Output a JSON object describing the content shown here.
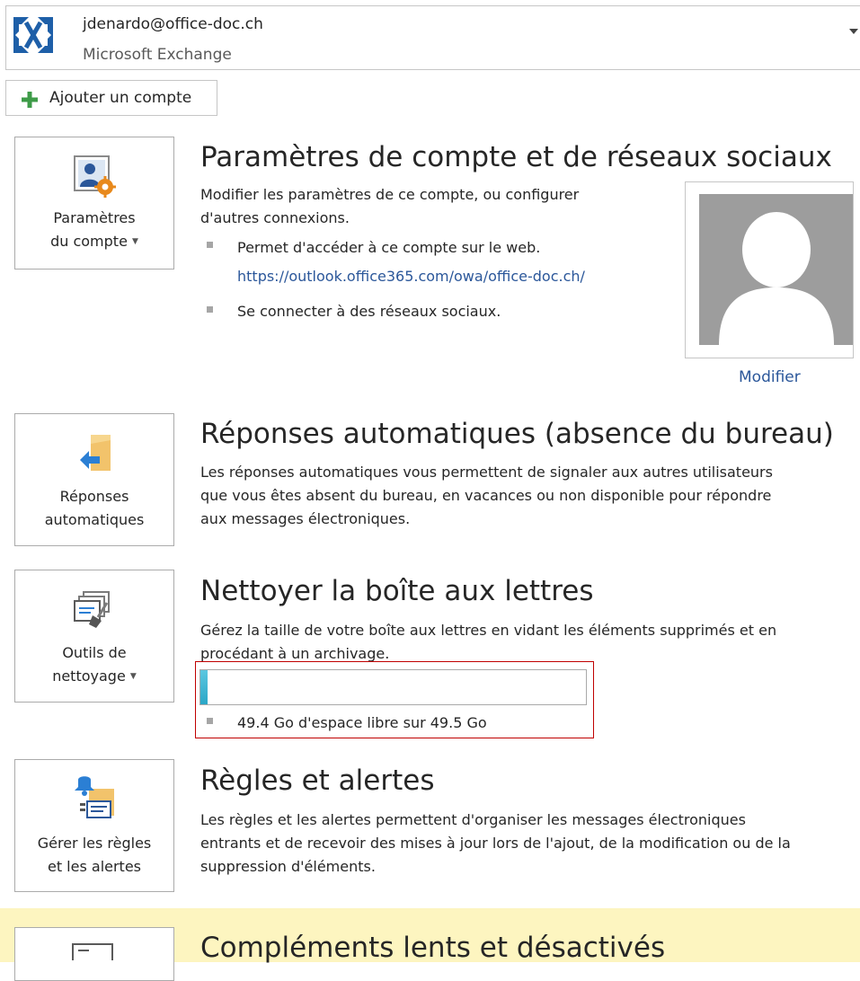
{
  "account": {
    "email": "jdenardo@office-doc.ch",
    "type": "Microsoft Exchange"
  },
  "add_account_label": "Ajouter un compte",
  "sections": {
    "account_settings": {
      "tile_line1": "Paramètres",
      "tile_line2": "du compte",
      "title": "Paramètres de compte et de réseaux sociaux",
      "desc_line1": "Modifier les paramètres de ce compte, ou configurer",
      "desc_line2": "d'autres connexions.",
      "bullet1": "Permet d'accéder à ce compte sur le web.",
      "link": "https://outlook.office365.com/owa/office-doc.ch/",
      "bullet2": "Se connecter à des réseaux sociaux.",
      "photo_action": "Modifier"
    },
    "auto_replies": {
      "tile_line1": "Réponses",
      "tile_line2": "automatiques",
      "title": "Réponses automatiques (absence du bureau)",
      "desc_line1": "Les réponses automatiques vous permettent de signaler aux autres utilisateurs",
      "desc_line2": "que vous êtes absent du bureau, en vacances ou non disponible pour répondre",
      "desc_line3": "aux messages électroniques."
    },
    "cleanup": {
      "tile_line1": "Outils de",
      "tile_line2": "nettoyage",
      "title": "Nettoyer la boîte aux lettres",
      "desc_line1": "Gérez la taille de votre boîte aux lettres en vidant les éléments supprimés et en",
      "desc_line2": "procédant à un archivage.",
      "quota_text": "49.4 Go d'espace libre sur 49.5 Go",
      "quota_used_fraction": 0.002
    },
    "rules": {
      "tile_line1": "Gérer les règles",
      "tile_line2": "et les alertes",
      "title": "Règles et alertes",
      "desc_line1": "Les règles et les alertes permettent d'organiser les messages électroniques",
      "desc_line2": "entrants et de recevoir des mises à jour lors de l'ajout, de la modification ou de la",
      "desc_line3": "suppression d'éléments."
    },
    "addins": {
      "title": "Compléments lents et désactivés"
    }
  },
  "colors": {
    "link": "#2b579a",
    "quota_fill": "#2aa6c7",
    "highlight_border": "#c00000",
    "warning_band": "#fdf5c0",
    "exchange_blue": "#1e5fa8"
  },
  "icons": {
    "account": "exchange-logo-icon",
    "add": "plus-icon",
    "settings": "account-settings-icon",
    "auto_replies": "auto-reply-icon",
    "cleanup": "cleanup-tools-icon",
    "rules": "rules-alerts-icon",
    "addins": "addins-icon"
  }
}
